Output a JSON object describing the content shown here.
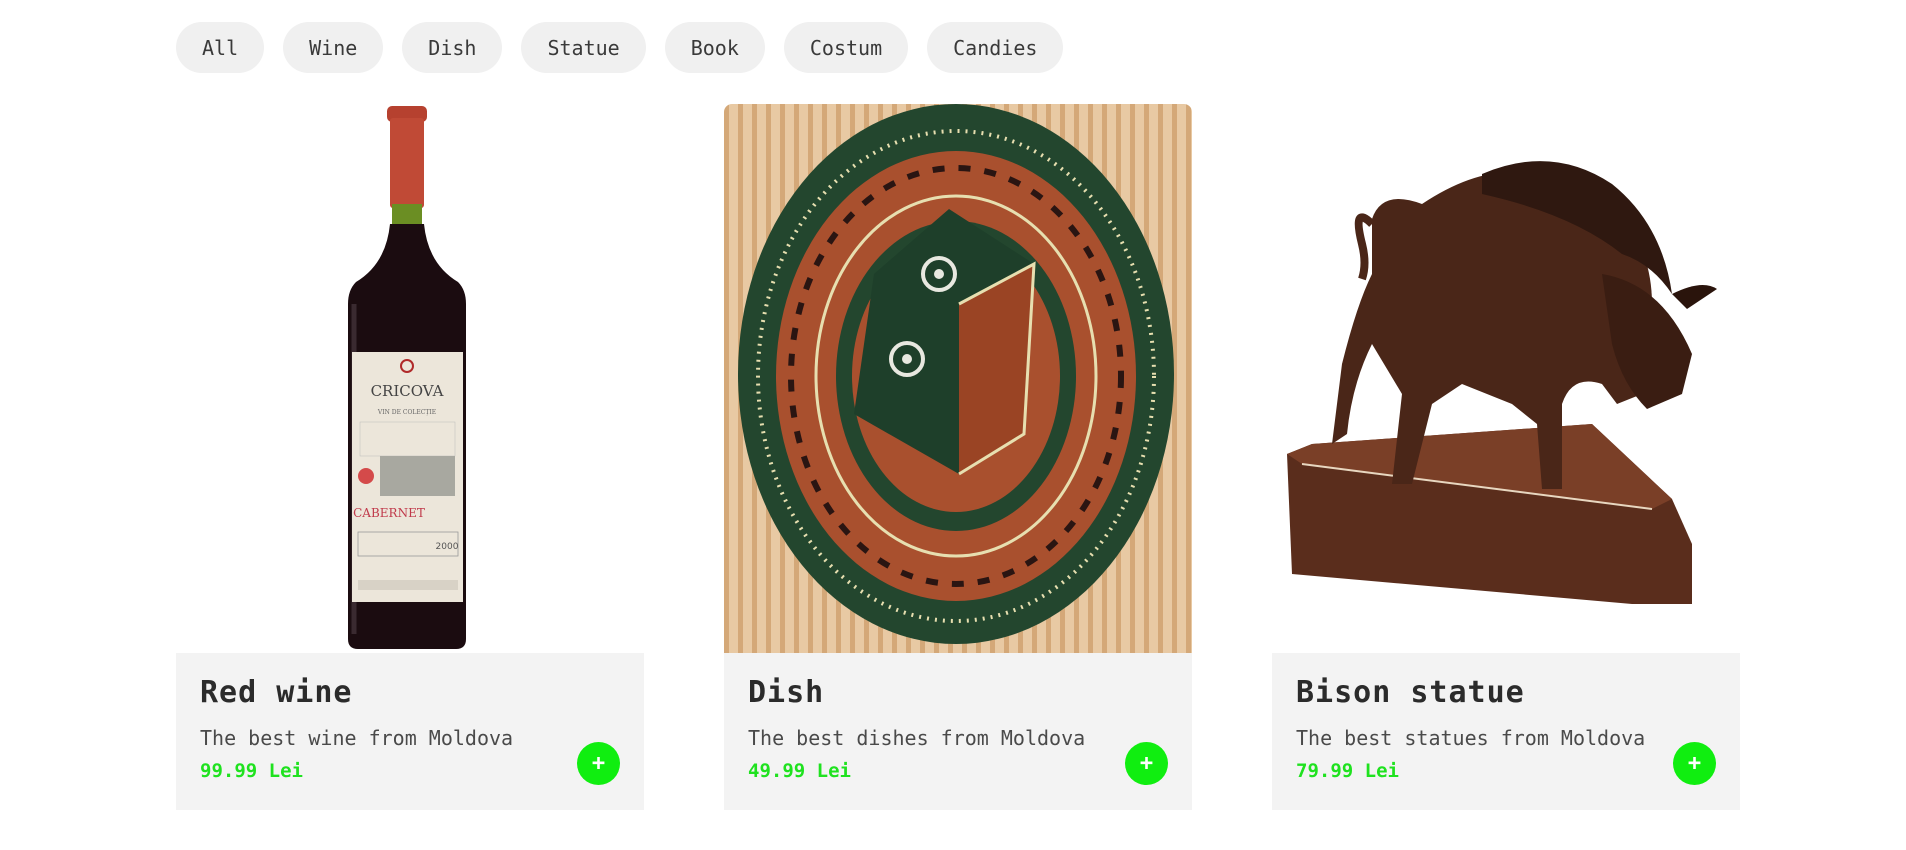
{
  "filters": [
    "All",
    "Wine",
    "Dish",
    "Statue",
    "Book",
    "Costum",
    "Candies"
  ],
  "products": [
    {
      "title": "Red wine",
      "description": "The best wine from Moldova",
      "price": "99.99 Lei",
      "add_label": "+",
      "image_icon": "wine-bottle-image",
      "label_text": "CRICOVA",
      "label_sub": "VIN DE COLECȚIE",
      "label_variety": "CABERNET",
      "label_year": "2000"
    },
    {
      "title": "Dish",
      "description": "The best dishes from Moldova",
      "price": "49.99 Lei",
      "add_label": "+",
      "image_icon": "ceramic-dish-image"
    },
    {
      "title": "Bison statue",
      "description": "The best statues from Moldova",
      "price": "79.99 Lei",
      "add_label": "+",
      "image_icon": "bison-statue-image"
    }
  ],
  "colors": {
    "accent": "#10ee10",
    "price": "#1fe21f",
    "chip_bg": "#f0f0f0",
    "card_info_bg": "#f3f3f3"
  }
}
